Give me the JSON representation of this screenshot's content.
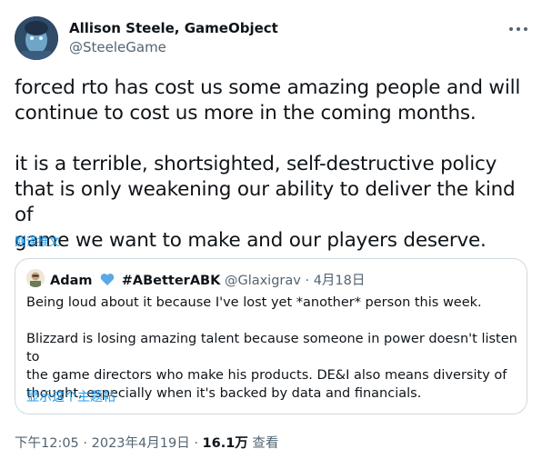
{
  "author": {
    "name": "Allison Steele, GameObject",
    "handle": "@SteeleGame"
  },
  "tweet": {
    "text": "forced rto has cost us some amazing people and will\ncontinue to cost us more in the coming months.\n\nit is a terrible, shortsighted, self-destructive policy\nthat is only weakening our ability to deliver the kind of\ngame we want to make and our players deserve.",
    "translate_label": "翻译推文"
  },
  "quote": {
    "name": "Adam",
    "hashtag": "#ABetterABK",
    "handle": "@Glaxigrav",
    "separator": "·",
    "date": "4月18日",
    "text": "Being loud about it because I've lost yet *another* person this week.\n\nBlizzard is losing amazing talent because someone in power doesn't listen to\nthe game directors who make his products. DE&I also means diversity of\nthought, especially when it's backed by data and financials.",
    "show_thread_label": "显示这个主题帖",
    "heart_color": "#5aa9e6"
  },
  "meta": {
    "time": "下午12:05",
    "date": "2023年4月19日",
    "separator": "·",
    "views_count": "16.1万",
    "views_label": "查看"
  }
}
